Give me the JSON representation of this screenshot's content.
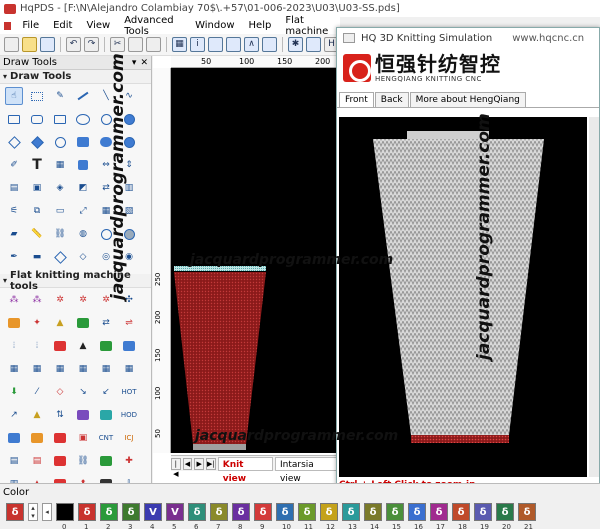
{
  "window": {
    "title": "HqPDS - [F:\\N\\Alejandro Colambiay 70$\\.+57\\01-006-2023\\U03\\U03-SS.pds]"
  },
  "menu": {
    "items": [
      "File",
      "Edit",
      "View",
      "Advanced Tools",
      "Window",
      "Help",
      "Flat machine"
    ]
  },
  "left_panel": {
    "header": "Draw Tools",
    "header_controls": [
      "▾",
      "✕"
    ],
    "section_draw": "Draw Tools",
    "section_flat": "Flat knitting machine tools"
  },
  "canvas": {
    "ruler_top": [
      "50",
      "100",
      "150",
      "200"
    ],
    "ruler_left": [
      "250",
      "200",
      "150",
      "100",
      "50"
    ],
    "view_tabs": [
      "Knit view",
      "Intarsia view"
    ],
    "active_tab": "Knit view"
  },
  "simulation": {
    "title": "HQ 3D Knitting Simulation",
    "url": "www.hqcnc.cn",
    "logo_cn": "恒强针纺智控",
    "logo_en": "HENGQIANG KNITTING CNC",
    "tabs": [
      "Front",
      "Back",
      "More about HengQiang"
    ],
    "active_tab": "Front",
    "status_hint": "Ctrl + Left Click to zoom-in"
  },
  "color_bar": {
    "label": "Color",
    "swatches": [
      {
        "color": "#c8332e",
        "glyph": "δ",
        "num": ""
      },
      {
        "color": "#000000",
        "glyph": "",
        "num": "0"
      },
      {
        "color": "#c8332e",
        "glyph": "δ",
        "num": "1"
      },
      {
        "color": "#2a9a3a",
        "glyph": "δ",
        "num": "2"
      },
      {
        "color": "#3e7a2e",
        "glyph": "δ",
        "num": "3"
      },
      {
        "color": "#3b3bb0",
        "glyph": "V",
        "num": "4"
      },
      {
        "color": "#7a2f8f",
        "glyph": "V",
        "num": "5"
      },
      {
        "color": "#2f8f7a",
        "glyph": "δ",
        "num": "6"
      },
      {
        "color": "#8a8a2a",
        "glyph": "δ",
        "num": "7"
      },
      {
        "color": "#6a2fa0",
        "glyph": "δ",
        "num": "8"
      },
      {
        "color": "#d33a3a",
        "glyph": "δ",
        "num": "9"
      },
      {
        "color": "#2f6fb0",
        "glyph": "δ",
        "num": "10"
      },
      {
        "color": "#6b9a2a",
        "glyph": "δ",
        "num": "11"
      },
      {
        "color": "#c4a21a",
        "glyph": "δ",
        "num": "12"
      },
      {
        "color": "#2a9a9a",
        "glyph": "δ",
        "num": "13"
      },
      {
        "color": "#7a7a2a",
        "glyph": "δ",
        "num": "14"
      },
      {
        "color": "#4a8f3a",
        "glyph": "δ",
        "num": "15"
      },
      {
        "color": "#3a6fd0",
        "glyph": "δ",
        "num": "16"
      },
      {
        "color": "#a02a8f",
        "glyph": "δ",
        "num": "17"
      },
      {
        "color": "#c04a2a",
        "glyph": "δ",
        "num": "18"
      },
      {
        "color": "#5a5ab0",
        "glyph": "δ",
        "num": "19"
      },
      {
        "color": "#2a7a4a",
        "glyph": "δ",
        "num": "20"
      },
      {
        "color": "#b05a2a",
        "glyph": "δ",
        "num": "21"
      }
    ]
  },
  "watermark": {
    "text": "jacquardprogrammer.com"
  }
}
